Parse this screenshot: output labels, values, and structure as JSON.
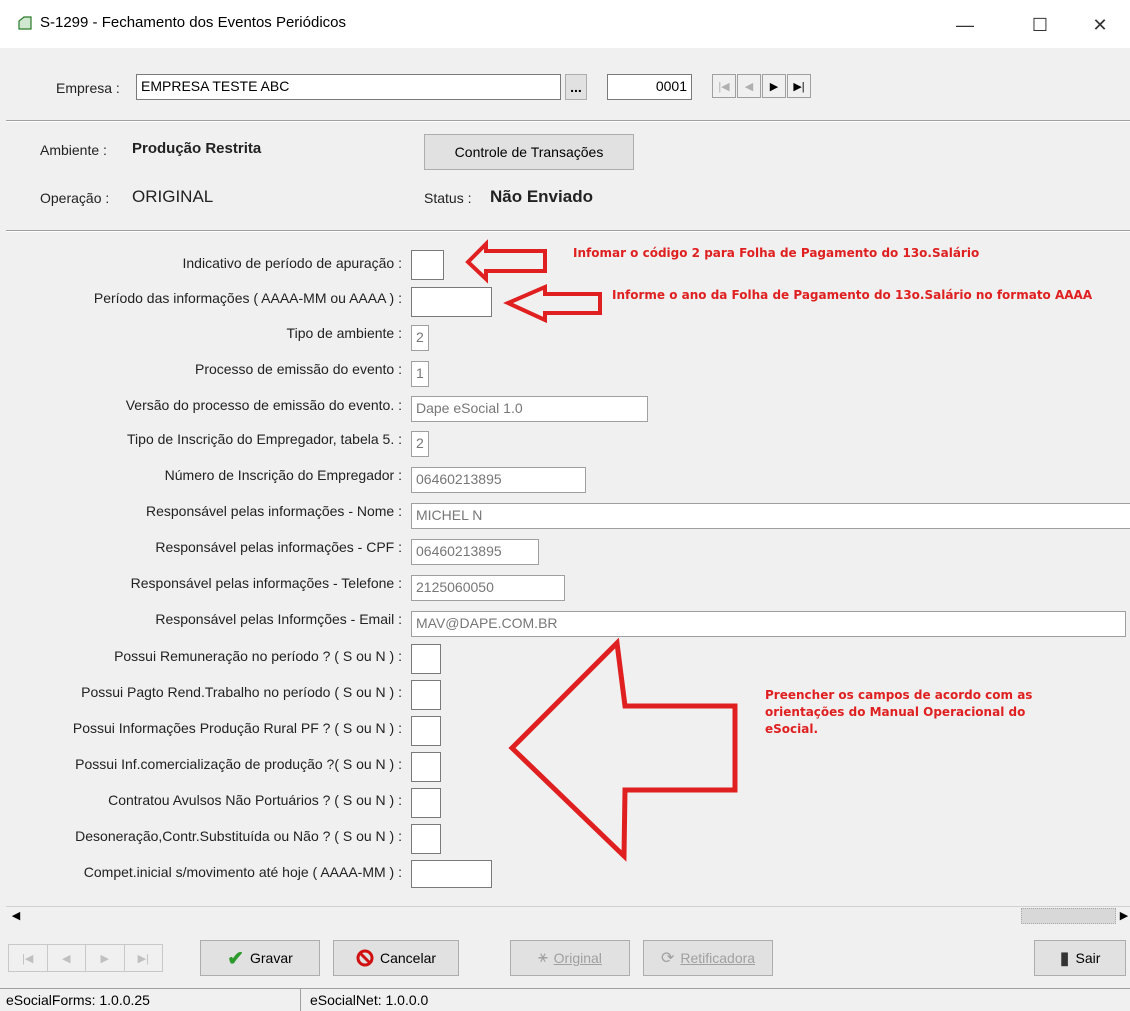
{
  "window": {
    "title": "S-1299 - Fechamento dos Eventos Periódicos",
    "minimize": "—",
    "maximize": "☐",
    "close": "✕"
  },
  "header": {
    "empresa_label": "Empresa :",
    "empresa_value": "EMPRESA TESTE ABC",
    "ellipsis": "...",
    "codigo": "0001",
    "ambiente_label": "Ambiente :",
    "ambiente_value": "Produção Restrita",
    "controle_button": "Controle de Transações",
    "operacao_label": "Operação :",
    "operacao_value": "ORIGINAL",
    "status_label": "Status :",
    "status_value": "Não Enviado"
  },
  "fields": [
    {
      "label": "Indicativo de período de apuração :",
      "value": ""
    },
    {
      "label": "Período das informações ( AAAA-MM ou AAAA ) :",
      "value": ""
    },
    {
      "label": "Tipo de ambiente :",
      "value": "2"
    },
    {
      "label": "Processo de emissão do evento :",
      "value": "1"
    },
    {
      "label": "Versão do processo de emissão do evento. :",
      "value": "Dape eSocial 1.0"
    },
    {
      "label": "Tipo de Inscrição do Empregador, tabela 5. :",
      "value": "2"
    },
    {
      "label": "Número de Inscrição do Empregador :",
      "value": "06460213895"
    },
    {
      "label": "Responsável pelas informações - Nome :",
      "value": "MICHEL N"
    },
    {
      "label": "Responsável pelas informações - CPF :",
      "value": "06460213895"
    },
    {
      "label": "Responsável pelas informações - Telefone :",
      "value": "2125060050"
    },
    {
      "label": "Responsável pelas Informções - Email :",
      "value": "MAV@DAPE.COM.BR"
    },
    {
      "label": "Possui Remuneração no período ? ( S ou N ) :",
      "value": ""
    },
    {
      "label": "Possui Pagto Rend.Trabalho no período ( S ou N ) :",
      "value": ""
    },
    {
      "label": "Possui Informações Produção Rural PF ? ( S ou N ) :",
      "value": ""
    },
    {
      "label": "Possui Inf.comercialização de produção ?( S ou N ) :",
      "value": ""
    },
    {
      "label": "Contratou Avulsos Não Portuários ? ( S ou N ) :",
      "value": ""
    },
    {
      "label": "Desoneração,Contr.Substituída ou Não ? ( S ou N ) :",
      "value": ""
    },
    {
      "label": "Compet.inicial s/movimento até hoje ( AAAA-MM ) :",
      "value": ""
    }
  ],
  "annotations": {
    "a1": "Infomar o código 2 para  Folha de Pagamento do 13o.Salário",
    "a2": "Informe o ano da Folha de Pagamento do 13o.Salário no formato AAAA",
    "a3_line1": "Preencher os campos de acordo com as",
    "a3_line2": "orientações do Manual Operacional do",
    "a3_line3": "eSocial."
  },
  "toolbar": {
    "gravar": "Gravar",
    "cancelar": "Cancelar",
    "original": "Original",
    "retificadora": "Retificadora",
    "sair": "Sair"
  },
  "statusbar": {
    "forms": "eSocialForms: 1.0.0.25",
    "net": "eSocialNet: 1.0.0.0"
  },
  "colors": {
    "annotation": "#e02020",
    "gravar_check": "#2e9a2e",
    "cancel_icon": "#d01010"
  }
}
